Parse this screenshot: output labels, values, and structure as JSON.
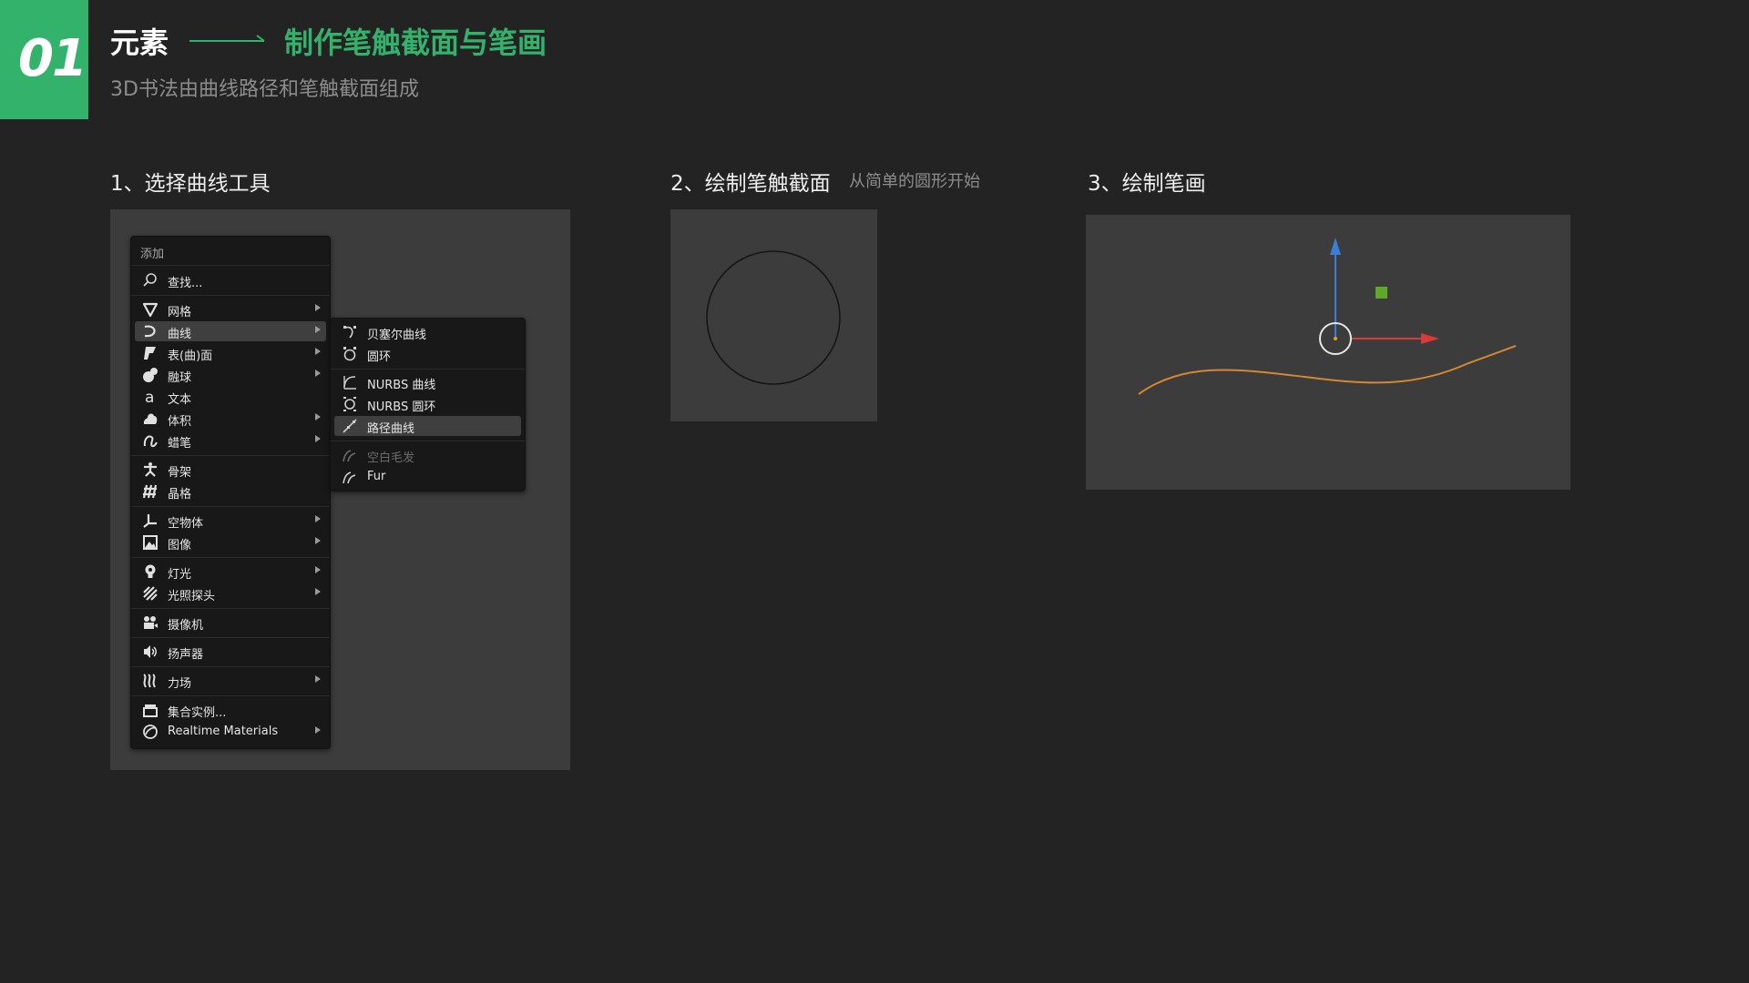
{
  "header": {
    "badge": "01",
    "title": "元素",
    "highlight": "制作笔触截面与笔画",
    "subtitle": "3D书法由曲线路径和笔触截面组成",
    "accent_color": "#33b26b"
  },
  "steps": [
    {
      "title": "1、选择曲线工具"
    },
    {
      "title": "2、绘制笔触截面",
      "note": "从简单的圆形开始"
    },
    {
      "title": "3、绘制笔画"
    }
  ],
  "add_menu": {
    "header": "添加",
    "search_label": "查找...",
    "items": [
      {
        "label": "网格",
        "icon": "mesh-icon",
        "submenu": true
      },
      {
        "label": "曲线",
        "icon": "curve-icon",
        "submenu": true,
        "active": true
      },
      {
        "label": "表(曲)面",
        "icon": "surface-icon",
        "submenu": true
      },
      {
        "label": "融球",
        "icon": "metaball-icon",
        "submenu": true
      },
      {
        "label": "文本",
        "icon": "text-icon",
        "submenu": false
      },
      {
        "label": "体积",
        "icon": "volume-icon",
        "submenu": true
      },
      {
        "label": "蜡笔",
        "icon": "grease-pencil-icon",
        "submenu": true
      },
      {
        "label": "骨架",
        "icon": "armature-icon",
        "submenu": false
      },
      {
        "label": "晶格",
        "icon": "lattice-icon",
        "submenu": false
      },
      {
        "label": "空物体",
        "icon": "empty-icon",
        "submenu": true
      },
      {
        "label": "图像",
        "icon": "image-icon",
        "submenu": true
      },
      {
        "label": "灯光",
        "icon": "light-icon",
        "submenu": true
      },
      {
        "label": "光照探头",
        "icon": "light-probe-icon",
        "submenu": true
      },
      {
        "label": "摄像机",
        "icon": "camera-icon",
        "submenu": false
      },
      {
        "label": "扬声器",
        "icon": "speaker-icon",
        "submenu": false
      },
      {
        "label": "力场",
        "icon": "force-field-icon",
        "submenu": true
      },
      {
        "label": "集合实例...",
        "icon": "collection-icon",
        "submenu": false
      },
      {
        "label": "Realtime Materials",
        "icon": "material-sphere-icon",
        "submenu": true
      }
    ]
  },
  "curve_submenu": {
    "items": [
      {
        "label": "贝塞尔曲线",
        "icon": "bezier-curve-icon"
      },
      {
        "label": "圆环",
        "icon": "bezier-circle-icon"
      },
      {
        "label": "NURBS 曲线",
        "icon": "nurbs-curve-icon"
      },
      {
        "label": "NURBS 圆环",
        "icon": "nurbs-circle-icon"
      },
      {
        "label": "路径曲线",
        "icon": "path-curve-icon",
        "active": true
      },
      {
        "label": "空白毛发",
        "icon": "hair-icon",
        "disabled": true
      },
      {
        "label": "Fur",
        "icon": "fur-icon"
      }
    ]
  },
  "viewport": {
    "stroke_color": "#d4882f",
    "axis_x_color": "#d93b3b",
    "axis_y_color": "#3a7fd5",
    "handle_color": "#5fa82a"
  }
}
